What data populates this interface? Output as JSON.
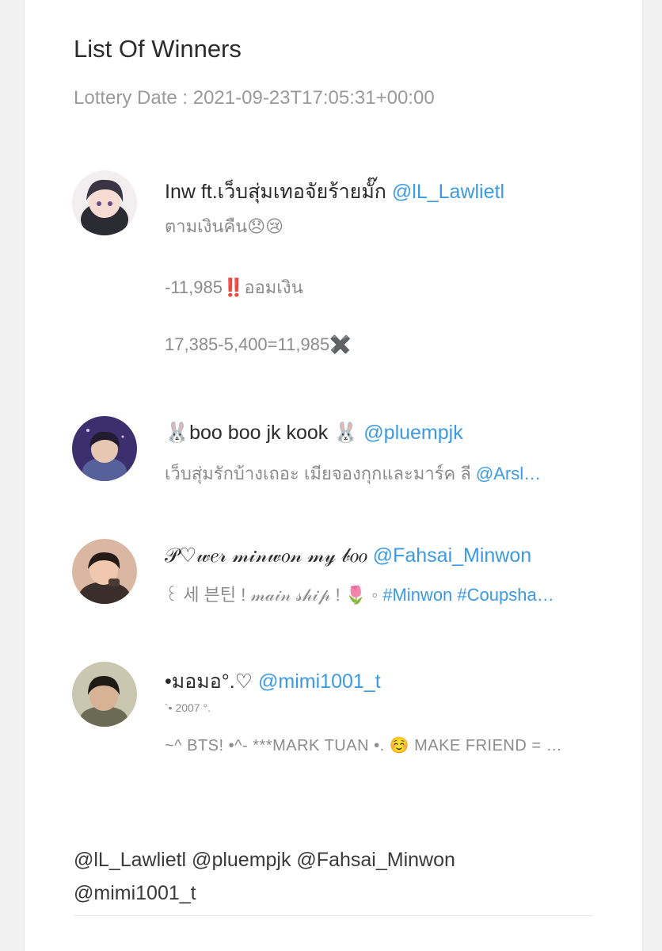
{
  "title": "List Of Winners",
  "lottery_date": "Lottery Date : 2021-09-23T17:05:31+00:00",
  "winners": [
    {
      "name": "Inw ft.เว็บสุ่มเทอจัยร้ายมั๊ก ",
      "handle": "@lL_Lawlietl",
      "bio": [
        "ตามเงินคืน😞😢",
        "-11,985‼️ออมเงิน",
        "17,385-5,400=11,985✖️"
      ]
    },
    {
      "name": "🐰boo boo jk kook 🐰 ",
      "handle": "@pluempjk",
      "bio_text": "เว็บสุ่มรักบ้างเถอะ เมียจองกุกและมาร์ค ลี ",
      "bio_link": "@Arsl…"
    },
    {
      "name": "𝒫♡𝓌𝑒𝓇 𝓂𝒾𝓃𝓌𝑜𝓃 𝓂𝓎 𝒷𝑜𝑜 ",
      "handle": "@Fahsai_Minwon",
      "bio_text": "꒰ 세 븐틴 ! 𝓂𝒶𝒾𝓃 𝓈𝒽𝒾𝓅 ! 🌷 ◦ ",
      "bio_link": "#Minwon #Coupsha…"
    },
    {
      "name": "•มอมอ°.♡ ",
      "handle": "@mimi1001_t",
      "bio": [
        "`• 2007 °.",
        "~^ BTS! •^- ***MARK TUAN •. ☺️ MAKE FRIEND = …"
      ]
    }
  ],
  "footer_mentions": "@lL_Lawlietl @pluempjk @Fahsai_Minwon @mimi1001_t",
  "colors": {
    "link": "#3b9ae1",
    "text": "#2b2b2b",
    "muted": "#9a9a9a"
  },
  "icons": [
    "avatar-1",
    "avatar-2",
    "avatar-3",
    "avatar-4"
  ]
}
